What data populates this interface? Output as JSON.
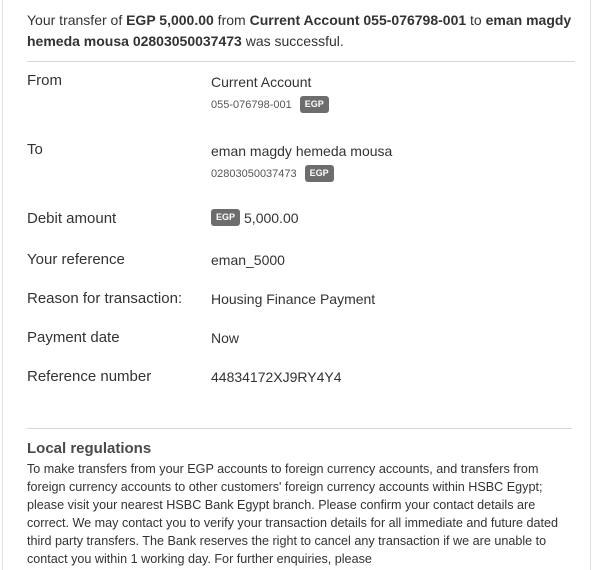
{
  "summary": {
    "p1": "Your transfer of ",
    "amount": "EGP 5,000.00",
    "p2": " from ",
    "account": "Current Account 055-076798-001",
    "p3": " to ",
    "payee": "eman magdy hemeda mousa 02803050037473",
    "p4": " was successful."
  },
  "details": {
    "from": {
      "label": "From",
      "value": "Current Account",
      "number": "055-076798-001",
      "currency": "EGP"
    },
    "to": {
      "label": "To",
      "value": "eman magdy hemeda mousa",
      "number": "02803050037473",
      "currency": "EGP"
    },
    "debit": {
      "label": "Debit amount",
      "currency": "EGP",
      "value": "5,000.00"
    },
    "your_reference": {
      "label": "Your reference",
      "value": "eman_5000"
    },
    "reason": {
      "label": "Reason for transaction:",
      "value": "Housing Finance Payment"
    },
    "payment_date": {
      "label": "Payment date",
      "value": "Now"
    },
    "reference_number": {
      "label": "Reference number",
      "value": "44834172XJ9RY4Y4"
    }
  },
  "regulations": {
    "title": "Local regulations",
    "text": "To make transfers from your EGP accounts to foreign currency accounts, and transfers from foreign currency accounts to other customers' foreign currency accounts within HSBC Egypt; please visit your nearest HSBC Bank Egypt branch. Please confirm your contact details are correct. We may contact you to verify your transaction details for all immediate and future dated third party transfers. The Bank reserves the right to cancel any transaction if we are unable to contact you within 1 working day. For further enquiries, please"
  }
}
